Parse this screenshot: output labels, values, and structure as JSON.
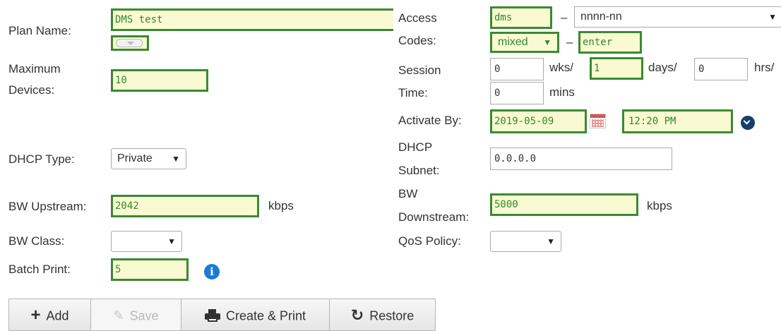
{
  "plan_name": {
    "label": "Plan Name:",
    "value": "DMS test"
  },
  "max_devices": {
    "label_line1": "Maximum",
    "label_line2": "Devices:",
    "value": "10"
  },
  "access_codes": {
    "label_line1": "Access",
    "label_line2": "Codes:",
    "prefix": "dms",
    "pattern": "nnnn-nn",
    "case": "mixed",
    "suffix": "enter",
    "dash": "–"
  },
  "session_time": {
    "label_line1": "Session",
    "label_line2": "Time:",
    "weeks": "0",
    "weeks_unit": "wks/",
    "days": "1",
    "days_unit": "days/",
    "hours": "0",
    "hours_unit": "hrs/",
    "mins": "0",
    "mins_unit": "mins"
  },
  "activate_by": {
    "label": "Activate By:",
    "date": "2019-05-09",
    "time": "12:20 PM"
  },
  "dhcp_type": {
    "label": "DHCP Type:",
    "value": "Private"
  },
  "dhcp_subnet": {
    "label_line1": "DHCP",
    "label_line2": "Subnet:",
    "value": "0.0.0.0"
  },
  "bw_upstream": {
    "label": "BW Upstream:",
    "value": "2042",
    "unit": "kbps"
  },
  "bw_downstream": {
    "label_line1": "BW",
    "label_line2": "Downstream:",
    "value": "5000",
    "unit": "kbps"
  },
  "bw_class": {
    "label": "BW Class:",
    "value": ""
  },
  "qos_policy": {
    "label": "QoS Policy:",
    "value": ""
  },
  "batch_print": {
    "label": "Batch Print:",
    "value": "5"
  },
  "buttons": {
    "add": "Add",
    "save": "Save",
    "create_print": "Create & Print",
    "restore": "Restore"
  },
  "colors": {
    "highlight_border": "#3a8a32",
    "highlight_bg": "#fafad2",
    "info_icon": "#1e7ad6",
    "dropdown_circle": "#173f6b"
  }
}
